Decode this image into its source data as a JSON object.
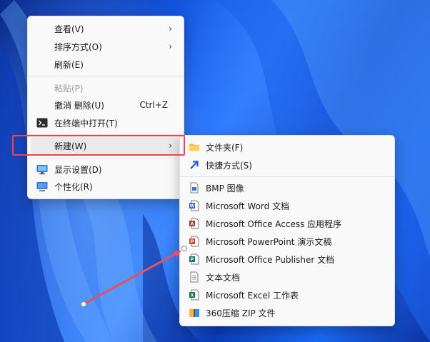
{
  "context_menu": {
    "items": [
      {
        "label": "查看(V)",
        "has_submenu": true
      },
      {
        "label": "排序方式(O)",
        "has_submenu": true
      },
      {
        "label": "刷新(E)"
      },
      {
        "label": "粘贴(P)",
        "disabled": true
      },
      {
        "label": "撤消 删除(U)",
        "shortcut": "Ctrl+Z"
      },
      {
        "label": "在终端中打开(T)",
        "icon": "terminal-icon"
      },
      {
        "label": "新建(W)",
        "has_submenu": true,
        "highlighted": true
      },
      {
        "label": "显示设置(D)",
        "icon": "display-settings-icon"
      },
      {
        "label": "个性化(R)",
        "icon": "personalize-icon"
      }
    ],
    "arrow_glyph": "›"
  },
  "new_submenu": {
    "items": [
      {
        "label": "文件夹(F)",
        "icon": "folder-icon"
      },
      {
        "label": "快捷方式(S)",
        "icon": "shortcut-icon"
      },
      {
        "label": "BMP 图像",
        "icon": "bmp-image-icon"
      },
      {
        "label": "Microsoft Word 文档",
        "icon": "word-icon"
      },
      {
        "label": "Microsoft Office Access 应用程序",
        "icon": "access-icon"
      },
      {
        "label": "Microsoft PowerPoint 演示文稿",
        "icon": "powerpoint-icon"
      },
      {
        "label": "Microsoft Office Publisher 文档",
        "icon": "publisher-icon"
      },
      {
        "label": "文本文档",
        "icon": "text-document-icon"
      },
      {
        "label": "Microsoft Excel 工作表",
        "icon": "excel-icon"
      },
      {
        "label": "360压缩 ZIP 文件",
        "icon": "zip-archive-icon"
      }
    ]
  },
  "colors": {
    "highlight_box": "#f4434f",
    "annotation_arrow": "#e8505b",
    "menu_background": "#f9f9f9"
  }
}
